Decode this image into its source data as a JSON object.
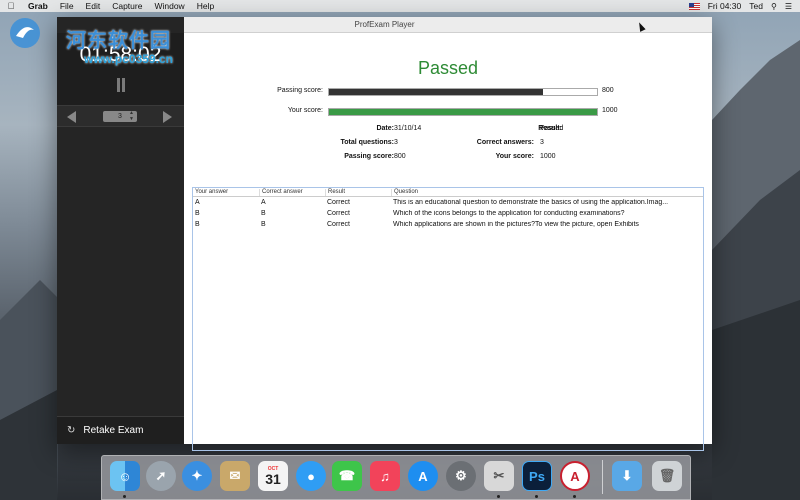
{
  "menubar": {
    "app_name": "Grab",
    "items": [
      "File",
      "Edit",
      "Capture",
      "Window",
      "Help"
    ],
    "clock": "Fri 04:30",
    "user": "Ted"
  },
  "window": {
    "title": "ProfExam Player"
  },
  "sidebar": {
    "timer": "01:58:02",
    "question_number": "3",
    "retake_label": "Retake Exam"
  },
  "result": {
    "status": "Passed",
    "status_color": "#2e8b35",
    "passing_score_label": "Passing score:",
    "passing_score_value": "800",
    "passing_score_fraction": 0.8,
    "your_score_label": "Your score:",
    "your_score_value": "1000",
    "your_score_fraction": 1.0,
    "info": {
      "date_label": "Date:",
      "date": "31/10/14",
      "result_label": "Result:",
      "result": "Passed",
      "total_label": "Total questions:",
      "total": "3",
      "correct_label": "Correct answers:",
      "correct": "3",
      "passing_label": "Passing score:",
      "passing": "800",
      "score_label": "Your score:",
      "score": "1000"
    }
  },
  "table": {
    "headers": [
      "Your answer",
      "Correct answer",
      "Result",
      "Question"
    ],
    "rows": [
      [
        "A",
        "A",
        "Correct",
        "This is an educational question to demonstrate the basics of using the application.Imag..."
      ],
      [
        "B",
        "B",
        "Correct",
        "Which of the icons belongs to the application for conducting examinations?"
      ],
      [
        "B",
        "B",
        "Correct",
        "Which applications are shown in the pictures?To view the picture, open Exhibits"
      ]
    ]
  },
  "dock": {
    "calendar_month": "OCT",
    "calendar_day": "31",
    "ps_label": "Ps"
  },
  "watermark": {
    "text": "河东软件园",
    "url": "www.pc0359.cn"
  }
}
